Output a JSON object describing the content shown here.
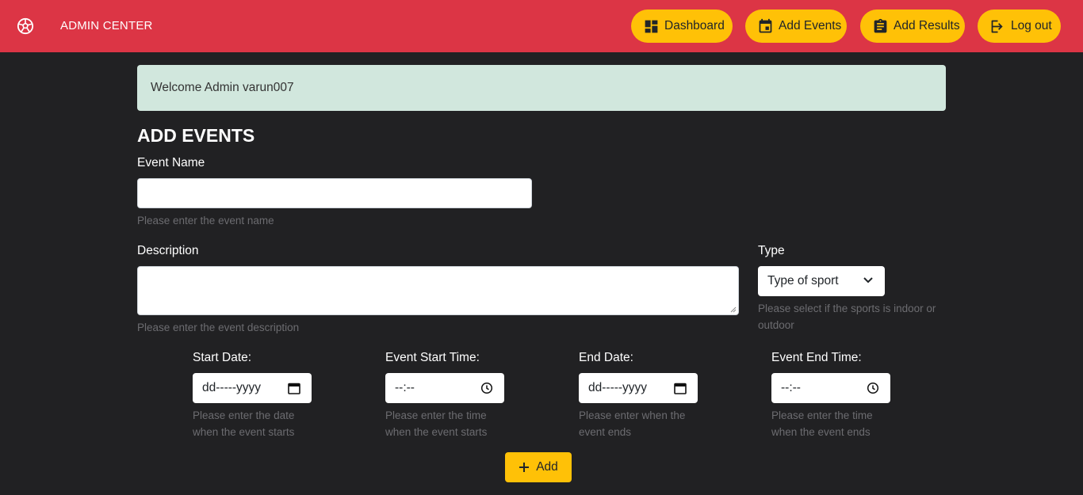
{
  "navbar": {
    "brand": "ADMIN CENTER",
    "buttons": {
      "dashboard": "Dashboard",
      "add_events": "Add Events",
      "add_results": "Add Results",
      "logout": "Log out"
    },
    "colors": {
      "background": "#dc3545",
      "button": "#ffc107"
    }
  },
  "alert": {
    "text": "Welcome Admin varun007"
  },
  "form": {
    "title": "ADD EVENTS",
    "event_name": {
      "label": "Event Name",
      "value": "",
      "help": "Please enter the event name"
    },
    "description": {
      "label": "Description",
      "value": "",
      "help": "Please enter the event description"
    },
    "type": {
      "label": "Type",
      "selected": "Type of sport",
      "help_line1": "Please select if the sports is indoor or",
      "help_line2": "outdoor"
    },
    "start_date": {
      "label": "Start Date:",
      "placeholder": "dd-----yyyy",
      "help_line1": "Please enter the date",
      "help_line2": "when the event starts"
    },
    "start_time": {
      "label": "Event Start Time:",
      "placeholder": "--:--",
      "help_line1": "Please enter the time",
      "help_line2": "when the event starts"
    },
    "end_date": {
      "label": "End Date:",
      "placeholder": "dd-----yyyy",
      "help_line1": "Please enter when the",
      "help_line2": "event ends"
    },
    "end_time": {
      "label": "Event End Time:",
      "placeholder": "--:--",
      "help_line1": "Please enter the time",
      "help_line2": "when the event ends"
    },
    "submit": "Add"
  },
  "icons": [
    "soccer-ball-icon",
    "dashboard-icon",
    "calendar-icon",
    "clipboard-icon",
    "logout-icon",
    "calendar-icon",
    "clock-icon",
    "plus-icon",
    "chevron-down-icon"
  ]
}
